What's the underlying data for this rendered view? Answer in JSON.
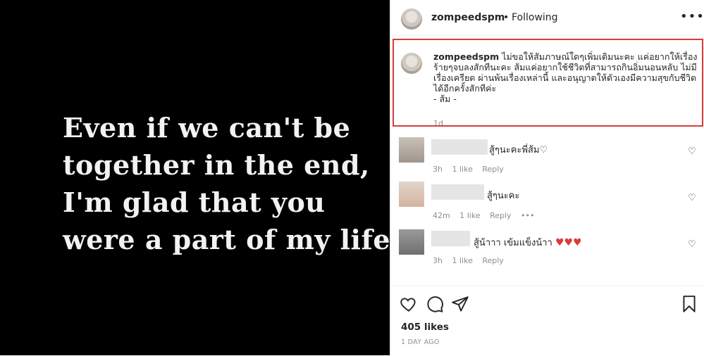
{
  "post": {
    "quote_lines": [
      "Even if we can't be",
      "together in the end,",
      "I'm glad that you",
      "were a part of my life."
    ]
  },
  "header": {
    "username": "zompeedspm",
    "separator": "•",
    "follow_status": "Following",
    "more_icon": "more-icon"
  },
  "caption": {
    "username": "zompeedspm",
    "text": "ไม่ขอให้สัมภาษณ์ใดๆเพิ่มเติมนะคะ แค่อยากให้เรื่องร้ายๆจบลงสักทีนะคะ ส้มแค่อยากใช้ชีวิตที่สามารถกินอิ่มนอนหลับ ไม่มีเรื่องเครียด ผ่านพ้นเรื่องเหล่านี้ และอนุญาตให้ตัวเองมีความสุขกับชีวิตได้อีกครั้งสักทีค่ะ",
    "signature": "- ส้ม -",
    "time": "1d",
    "highlight_color": "#d93b3b"
  },
  "comments": [
    {
      "text": "สู้ๆนะคะพี่ส้ม♡",
      "time": "3h",
      "likes": "1 like",
      "reply": "Reply"
    },
    {
      "text": "สู้ๆนะคะ",
      "time": "42m",
      "likes": "1 like",
      "reply": "Reply",
      "more": "•••"
    },
    {
      "text": "สู้น้าาา เข้มแข็งน้าา",
      "hearts": "♥♥♥",
      "time": "3h",
      "likes": "1 like",
      "reply": "Reply"
    }
  ],
  "actions": {
    "likes": "405 likes",
    "timestamp": "1 DAY AGO"
  }
}
